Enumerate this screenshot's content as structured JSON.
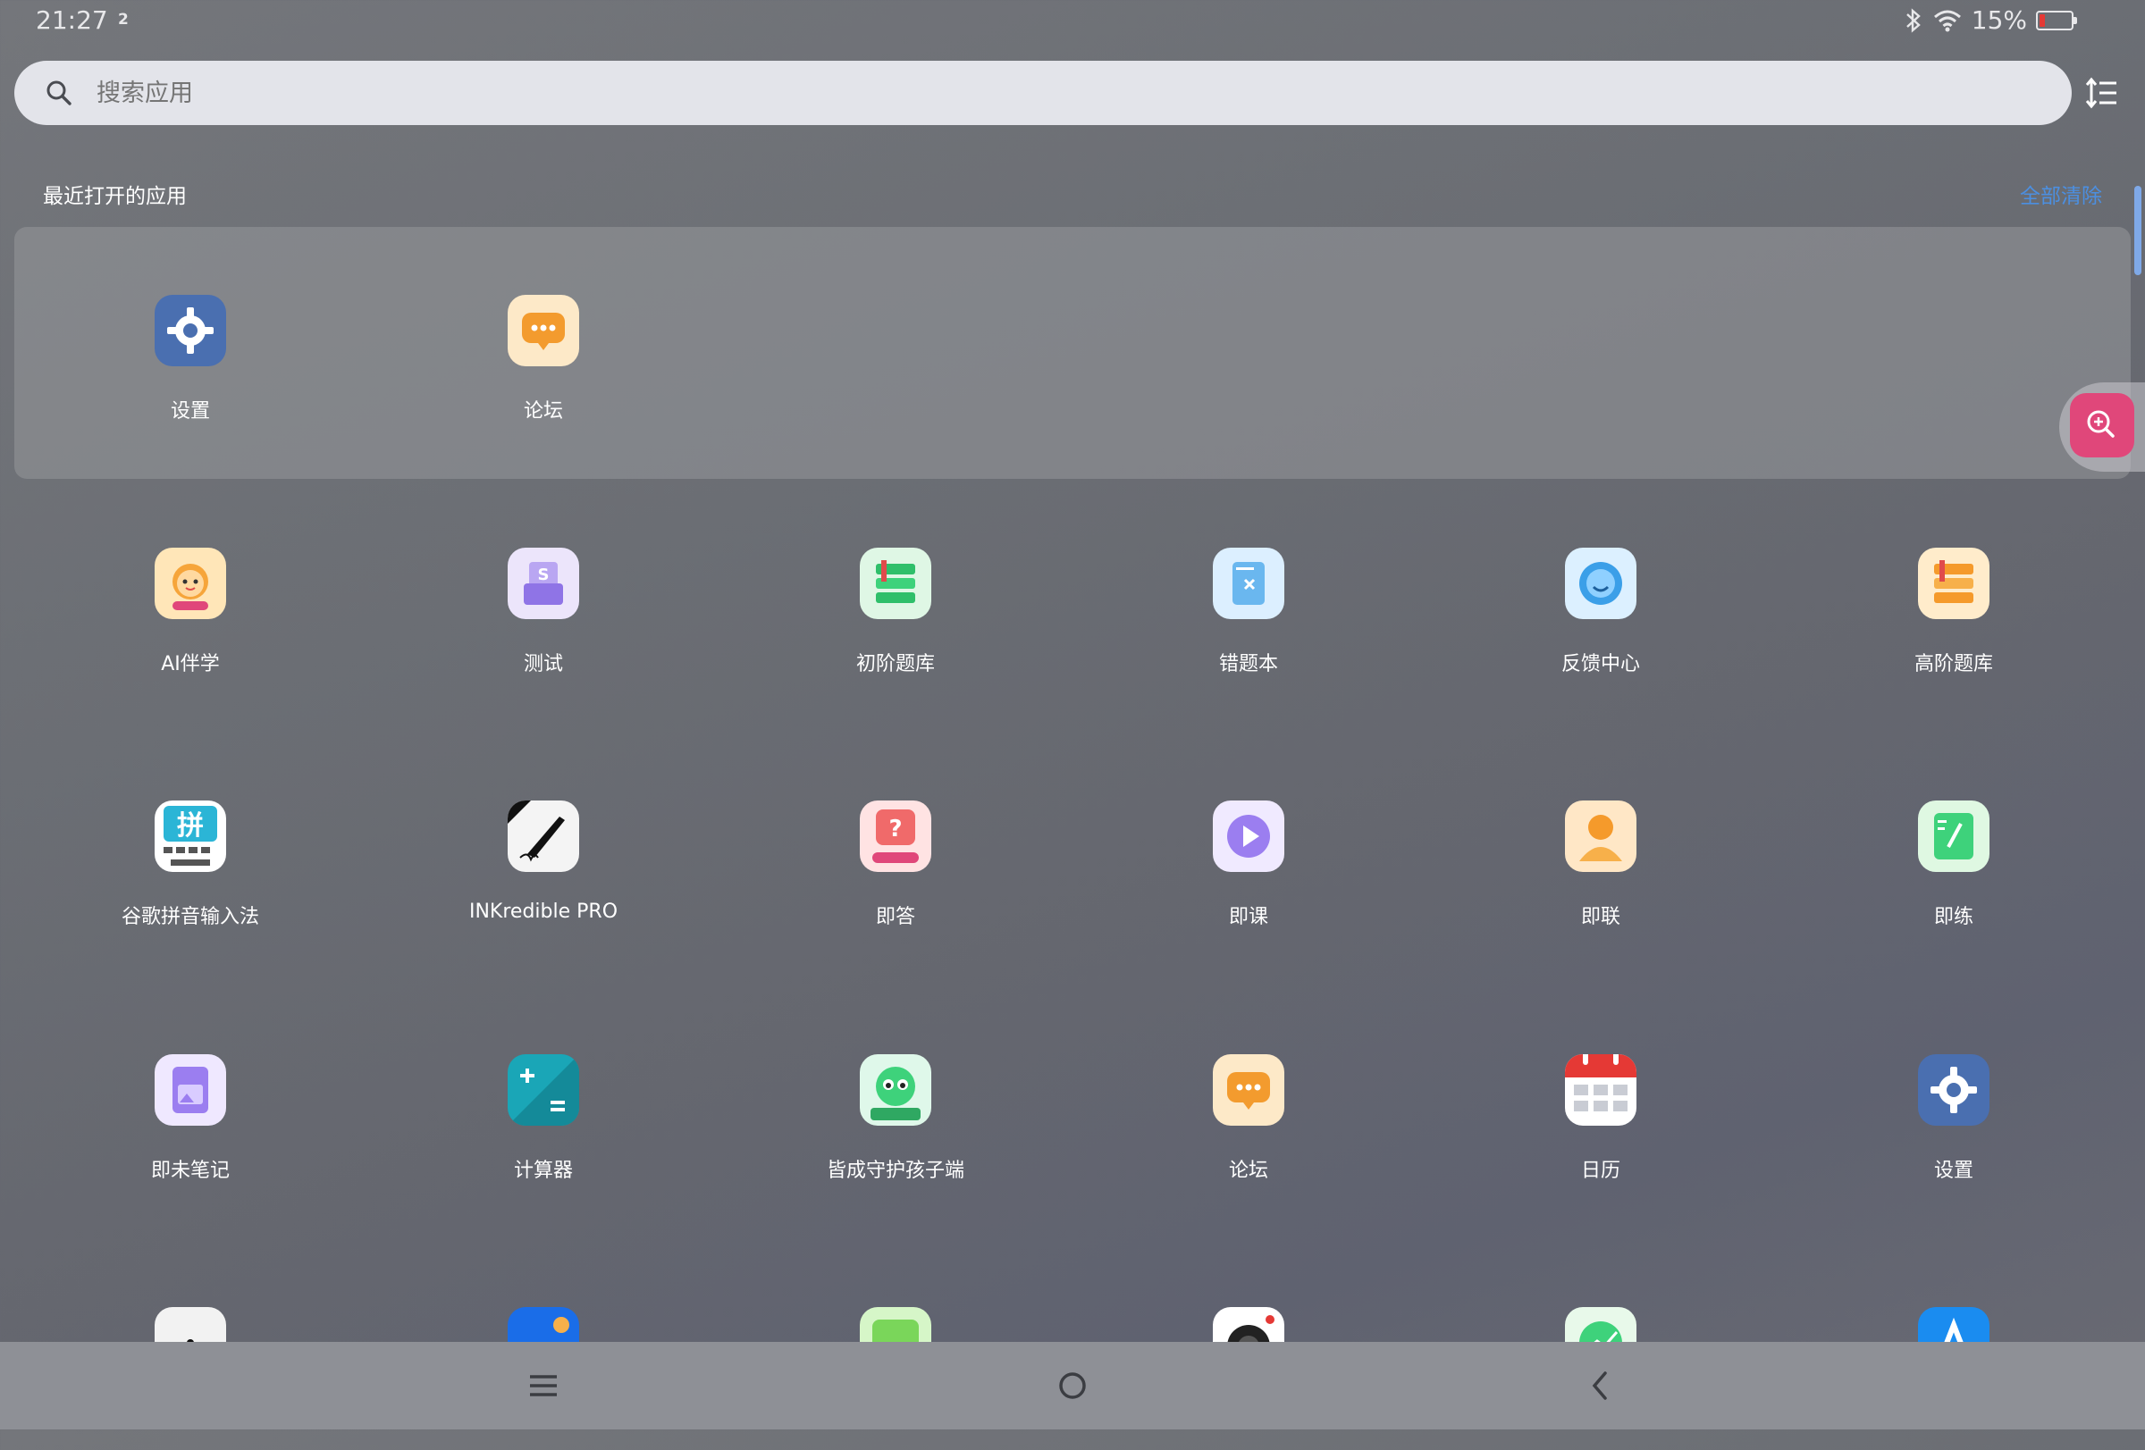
{
  "status_bar": {
    "time": "21:27",
    "notification_count": "2",
    "battery_percent": "15%",
    "battery_level": 0.15
  },
  "search": {
    "placeholder": "搜索应用"
  },
  "recent": {
    "title": "最近打开的应用",
    "clear_all": "全部清除",
    "apps": [
      {
        "label": "设置",
        "icon": "settings-icon"
      },
      {
        "label": "论坛",
        "icon": "forum-icon"
      }
    ]
  },
  "apps": [
    {
      "label": "AI伴学",
      "icon": "ai-companion-icon"
    },
    {
      "label": "测试",
      "icon": "test-icon"
    },
    {
      "label": "初阶题库",
      "icon": "beginner-question-bank-icon"
    },
    {
      "label": "错题本",
      "icon": "mistake-book-icon"
    },
    {
      "label": "反馈中心",
      "icon": "feedback-center-icon"
    },
    {
      "label": "高阶题库",
      "icon": "advanced-question-bank-icon"
    },
    {
      "label": "谷歌拼音输入法",
      "icon": "google-pinyin-icon"
    },
    {
      "label": "INKredible PRO",
      "icon": "inkredible-pen-icon"
    },
    {
      "label": "即答",
      "icon": "quick-answer-icon"
    },
    {
      "label": "即课",
      "icon": "course-play-icon"
    },
    {
      "label": "即联",
      "icon": "contact-icon"
    },
    {
      "label": "即练",
      "icon": "practice-icon"
    },
    {
      "label": "即未笔记",
      "icon": "notes-icon"
    },
    {
      "label": "计算器",
      "icon": "calculator-icon"
    },
    {
      "label": "皆成守护孩子端",
      "icon": "guardian-kids-icon"
    },
    {
      "label": "论坛",
      "icon": "forum-icon"
    },
    {
      "label": "日历",
      "icon": "calendar-icon"
    },
    {
      "label": "设置",
      "icon": "settings-icon"
    },
    {
      "label": "",
      "icon": "app-partial-icon"
    },
    {
      "label": "",
      "icon": "app-partial-icon"
    },
    {
      "label": "",
      "icon": "app-partial-icon"
    },
    {
      "label": "",
      "icon": "camera-icon"
    },
    {
      "label": "",
      "icon": "app-partial-icon"
    },
    {
      "label": "",
      "icon": "app-store-icon"
    }
  ],
  "colors": {
    "accent": "#4c8fe0",
    "zoom_button": "#e0477a"
  }
}
